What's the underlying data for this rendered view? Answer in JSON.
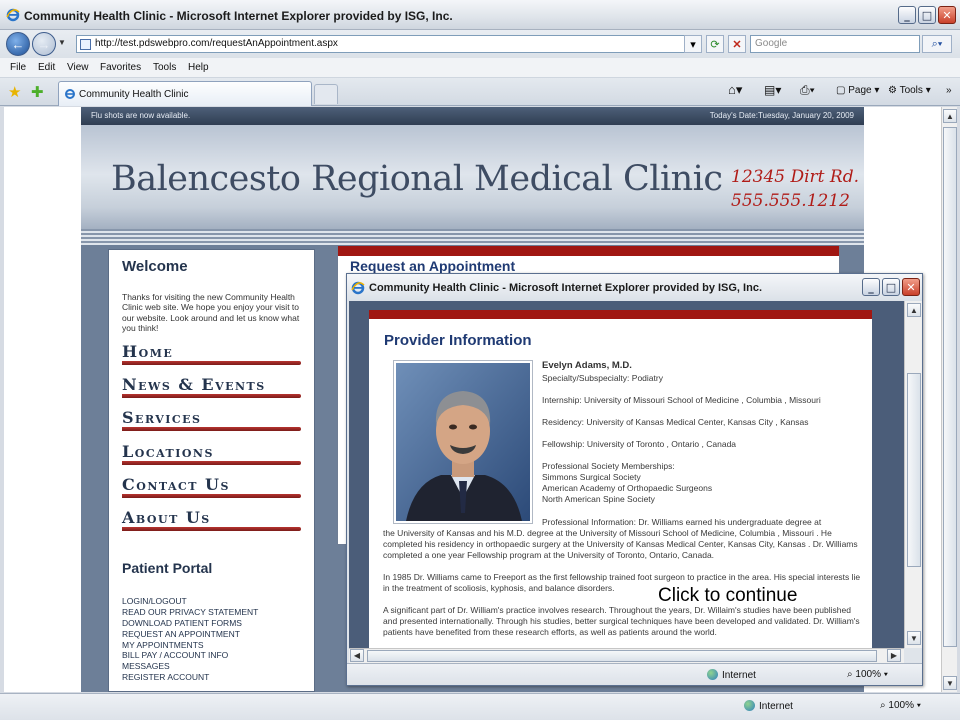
{
  "window": {
    "title": "Community Health Clinic - Microsoft Internet Explorer provided by ISG, Inc.",
    "minimize": "_",
    "maximize": "□",
    "close": "✕"
  },
  "address": {
    "url": "http://test.pdswebpro.com/requestAnAppointment.aspx",
    "search_placeholder": "Google"
  },
  "menu": [
    "File",
    "Edit",
    "View",
    "Favorites",
    "Tools",
    "Help"
  ],
  "tab": {
    "label": "Community Health Clinic"
  },
  "commands": {
    "page": "Page",
    "tools": "Tools"
  },
  "site": {
    "top_left": "Flu shots are now available.",
    "top_right": "Today's Date:Tuesday, January 20, 2009",
    "clinic_name": "Balencesto Regional Medical Clinic",
    "address": "12345 Dirt Rd.",
    "phone": "555.555.1212",
    "welcome_title": "Welcome",
    "welcome_text": "Thanks for visiting the new Community Health Clinic web site. We hope you enjoy your visit to our website. Look around and let us know what you think!",
    "nav": [
      "Home",
      "News & Events",
      "Services",
      "Locations",
      "Contact Us",
      "About Us"
    ],
    "portal_title": "Patient Portal",
    "portal_links": [
      "LOGIN/LOGOUT",
      "READ OUR PRIVACY STATEMENT",
      "DOWNLOAD PATIENT FORMS",
      "REQUEST AN APPOINTMENT",
      "MY APPOINTMENTS",
      "BILL PAY / ACCOUNT INFO",
      "MESSAGES",
      "REGISTER ACCOUNT"
    ],
    "panel_heading": "Request an Appointment"
  },
  "status": {
    "zone": "Internet",
    "zoom": "100%"
  },
  "popup": {
    "title": "Community Health Clinic - Microsoft Internet Explorer provided by ISG, Inc.",
    "heading": "Provider Information",
    "name": "Evelyn Adams, M.D.",
    "specialty": "Specialty/Subspecialty: Podiatry",
    "internship": "Internship: University of Missouri School of Medicine , Columbia , Missouri",
    "residency": "Residency: University of Kansas Medical Center, Kansas City , Kansas",
    "fellowship": "Fellowship: University of Toronto , Ontario , Canada",
    "memberships_label": "Professional Society Memberships:",
    "memberships": [
      "Simmons Surgical Society",
      "American Academy of Orthopaedic Surgeons",
      "North American Spine Society"
    ],
    "prof_info_first": "Professional Information: Dr. Williams earned his undergraduate degree at",
    "prof_info_rest": "the University of Kansas and his M.D. degree at the University of Missouri School of Medicine, Columbia , Missouri . He completed his residency in orthopaedic surgery at the University of Kansas Medical Center, Kansas City, Kansas . Dr. Williams completed a one year Fellowship program at the University of Toronto, Ontario, Canada.",
    "para2": "In 1985 Dr. Williams came to Freeport as the first fellowship trained foot surgeon to practice in the area. His special interests lie in the treatment of scoliosis, kyphosis, and balance disorders.",
    "para3": "A significant part of Dr. William's practice involves research. Throughout the years, Dr. Willaim's studies have been published and presented internationally. Through his studies, better surgical techniques have been developed and validated. Dr. William's patients have benefited from these research efforts, as well as patients around the world.",
    "overlay": "Click to continue",
    "status_zone": "Internet",
    "status_zoom": "100%"
  }
}
